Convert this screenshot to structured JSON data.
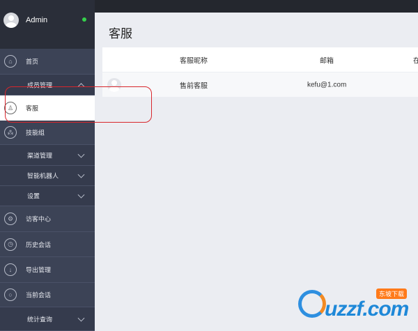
{
  "user": {
    "name": "Admin",
    "status_color": "#35d04b"
  },
  "nav": {
    "home": "首页",
    "members": "成员管理",
    "service": "客服",
    "skills": "技能组",
    "channels": "渠道管理",
    "robot": "智能机器人",
    "settings": "设置",
    "visitors": "访客中心",
    "history": "历史会话",
    "export": "导出管理",
    "current": "当前会话",
    "stats": "统计查询"
  },
  "page": {
    "title": "客服"
  },
  "table": {
    "headers": [
      "客服昵称",
      "邮箱",
      "在"
    ],
    "rows": [
      {
        "nickname": "售前客服",
        "email": "kefu@1.com"
      }
    ]
  },
  "watermark": {
    "text": "uzzf.com",
    "badge": "东坡下载"
  },
  "colors": {
    "sidebar": "#3c4356",
    "accent_annotation": "#d8262c",
    "online": "#35d04b"
  }
}
